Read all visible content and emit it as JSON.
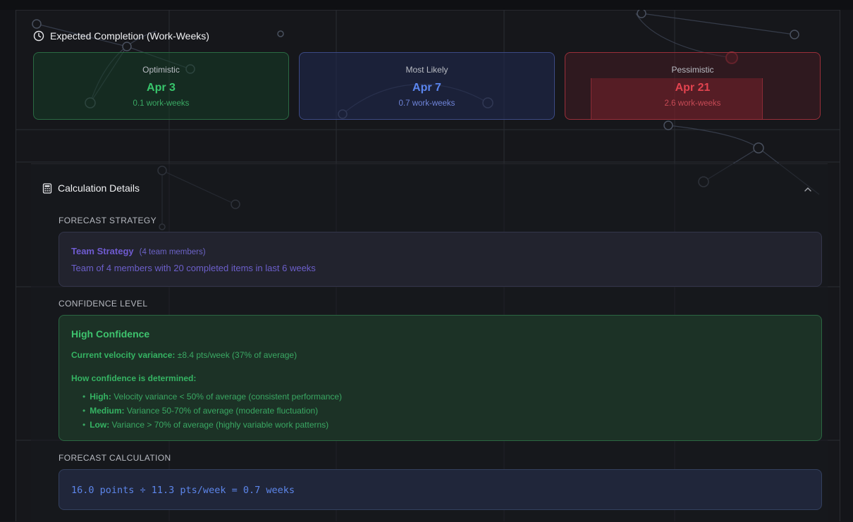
{
  "expected_completion": {
    "title": "Expected Completion (Work-Weeks)",
    "icon": "clock-icon",
    "cards": [
      {
        "label": "Optimistic",
        "date": "Apr 3",
        "weeks": "0.1 work-weeks",
        "color": "#38c66c"
      },
      {
        "label": "Most Likely",
        "date": "Apr 7",
        "weeks": "0.7 work-weeks",
        "color": "#5b86f0"
      },
      {
        "label": "Pessimistic",
        "date": "Apr 21",
        "weeks": "2.6 work-weeks",
        "color": "#e2434f"
      }
    ]
  },
  "calculation_details": {
    "title": "Calculation Details",
    "icon": "calculator-icon",
    "collapse_icon": "chevron-up-icon",
    "strategy": {
      "label": "FORECAST STRATEGY",
      "name": "Team Strategy",
      "meta": "(4 team members)",
      "description": "Team of 4 members with 20 completed items in last 6 weeks"
    },
    "confidence": {
      "label": "CONFIDENCE LEVEL",
      "title": "High Confidence",
      "variance_label": "Current velocity variance:",
      "variance_value": "±8.4 pts/week (37% of average)",
      "how_label": "How confidence is determined:",
      "rules": [
        {
          "level": "High:",
          "text": "Velocity variance < 50% of average (consistent performance)"
        },
        {
          "level": "Medium:",
          "text": "Variance 50-70% of average (moderate fluctuation)"
        },
        {
          "level": "Low:",
          "text": "Variance > 70% of average (highly variable work patterns)"
        }
      ]
    },
    "calculation": {
      "label": "FORECAST CALCULATION",
      "formula": "16.0 points ÷ 11.3 pts/week = 0.7 weeks"
    }
  }
}
